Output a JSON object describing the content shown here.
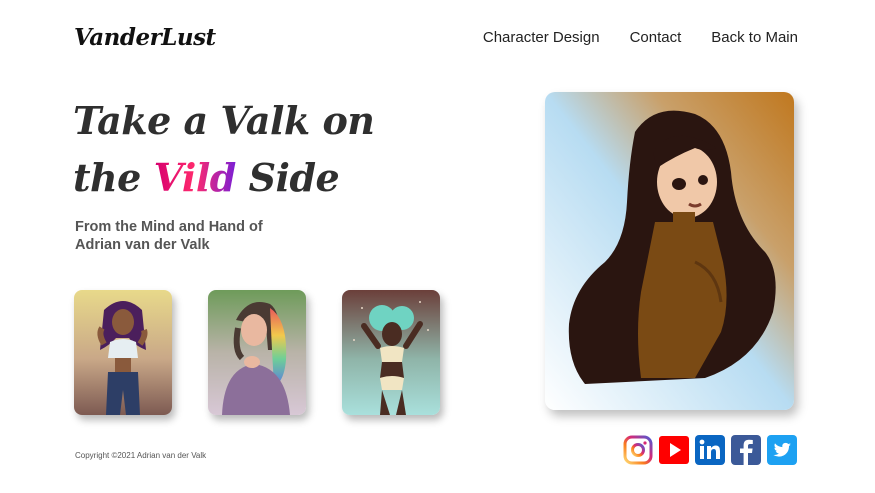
{
  "brand": {
    "logo_text": "VanderLust"
  },
  "nav": {
    "items": [
      {
        "label": "Character Design"
      },
      {
        "label": "Contact"
      },
      {
        "label": "Back to Main"
      }
    ]
  },
  "hero": {
    "title_line1": "Take a Valk on",
    "title_line2_pre": "the ",
    "title_highlight": "Vild",
    "title_line2_post": " Side",
    "subtitle_line1": "From the Mind and Hand of",
    "subtitle_line2": "Adrian van der Valk"
  },
  "gallery": {
    "thumbnails": [
      {
        "icon": "character-illustration-purple-hair"
      },
      {
        "icon": "character-illustration-rainbow-hair"
      },
      {
        "icon": "character-illustration-teal-hair"
      }
    ],
    "featured": {
      "icon": "character-illustration-long-dark-hair"
    }
  },
  "footer": {
    "copyright": "Copyright ©2021 Adrian van der Valk"
  },
  "socials": [
    {
      "icon": "instagram-icon",
      "color": "#d62976"
    },
    {
      "icon": "youtube-icon",
      "color": "#ff0000"
    },
    {
      "icon": "linkedin-icon",
      "color": "#0a66c2"
    },
    {
      "icon": "facebook-icon",
      "color": "#3b5998"
    },
    {
      "icon": "twitter-icon",
      "color": "#1da1f2"
    }
  ],
  "colors": {
    "accent_gradient_start": "#d6006f",
    "accent_gradient_end": "#7a1fd6",
    "text_dark": "#2f2f2f"
  }
}
